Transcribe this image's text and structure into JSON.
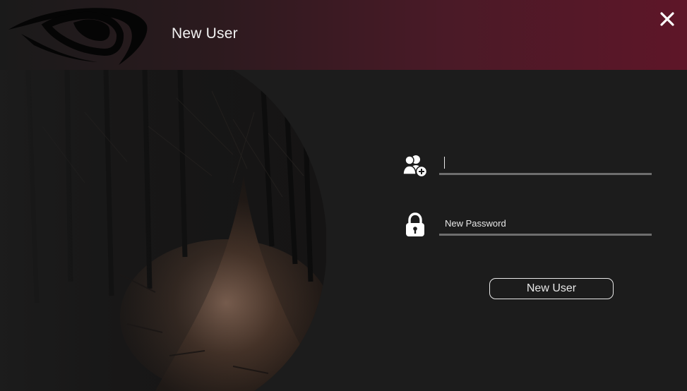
{
  "window": {
    "title": "New User",
    "close_icon": "close-icon",
    "logo_icon": "eye-logo-icon",
    "header_gradient": [
      "#1a1a1a",
      "#5e1628"
    ],
    "background": "#1c1c1c"
  },
  "form": {
    "username": {
      "icon": "add-user-icon",
      "value": "",
      "placeholder": ""
    },
    "password": {
      "icon": "lock-icon",
      "value": "",
      "placeholder": "New Password"
    },
    "submit_label": "New User"
  },
  "colors": {
    "text": "#e8e8e8",
    "underline": "#6e6e6e",
    "accent": "#5e1628"
  }
}
